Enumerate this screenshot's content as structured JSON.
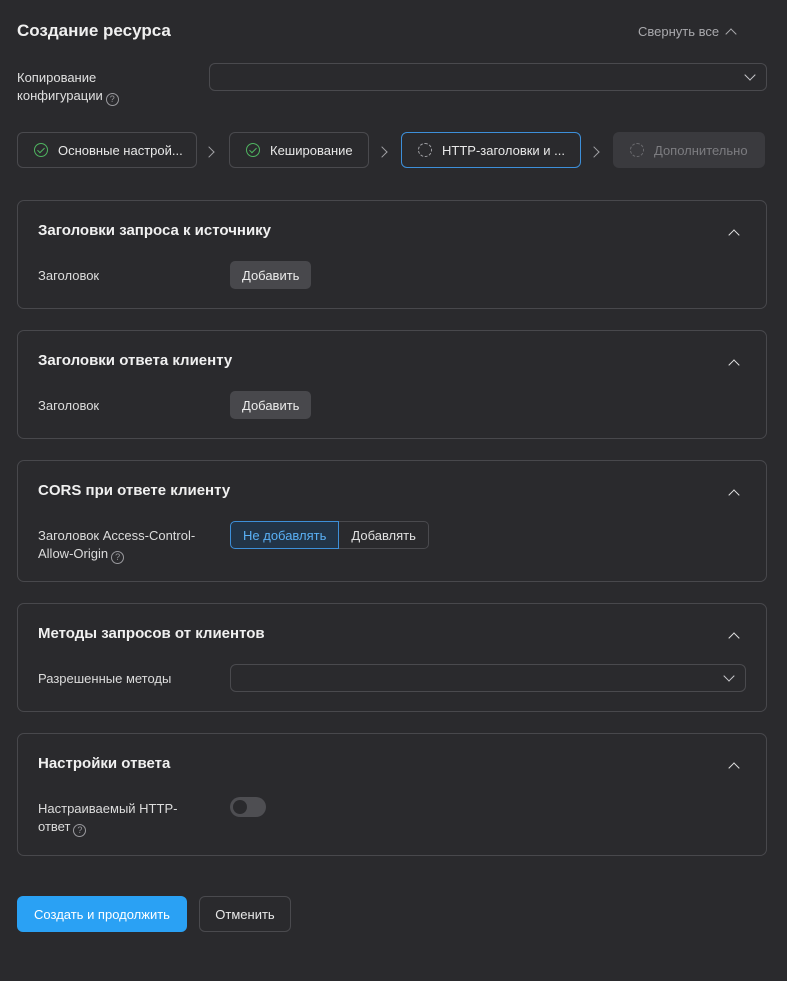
{
  "header": {
    "title": "Создание ресурса",
    "collapse_all": "Свернуть все"
  },
  "copy_config": {
    "label_line1": "Копирование",
    "label_line2": "конфигурации",
    "value": ""
  },
  "steps": [
    {
      "label": "Основные настрой...",
      "state": "done"
    },
    {
      "label": "Кеширование",
      "state": "done"
    },
    {
      "label": "HTTP-заголовки и ...",
      "state": "active"
    },
    {
      "label": "Дополнительно",
      "state": "disabled"
    }
  ],
  "sections": {
    "request_headers": {
      "title": "Заголовки запроса к источнику",
      "field_label": "Заголовок",
      "button": "Добавить"
    },
    "response_headers": {
      "title": "Заголовки ответа клиенту",
      "field_label": "Заголовок",
      "button": "Добавить"
    },
    "cors": {
      "title": "CORS при ответе клиенту",
      "field_label_line1": "Заголовок Access-Control-",
      "field_label_line2": "Allow-Origin",
      "options": [
        "Не добавлять",
        "Добавлять"
      ],
      "selected": "Не добавлять"
    },
    "methods": {
      "title": "Методы запросов от клиентов",
      "field_label": "Разрешенные методы",
      "value": ""
    },
    "response_settings": {
      "title": "Настройки ответа",
      "field_label_line1": "Настраиваемый HTTP-",
      "field_label_line2": "ответ",
      "toggle_on": false
    }
  },
  "footer": {
    "primary": "Создать и продолжить",
    "cancel": "Отменить"
  },
  "colors": {
    "background": "#2a2a2d",
    "accent": "#2aa1f4",
    "success": "#4fb460",
    "border": "#48484c"
  }
}
